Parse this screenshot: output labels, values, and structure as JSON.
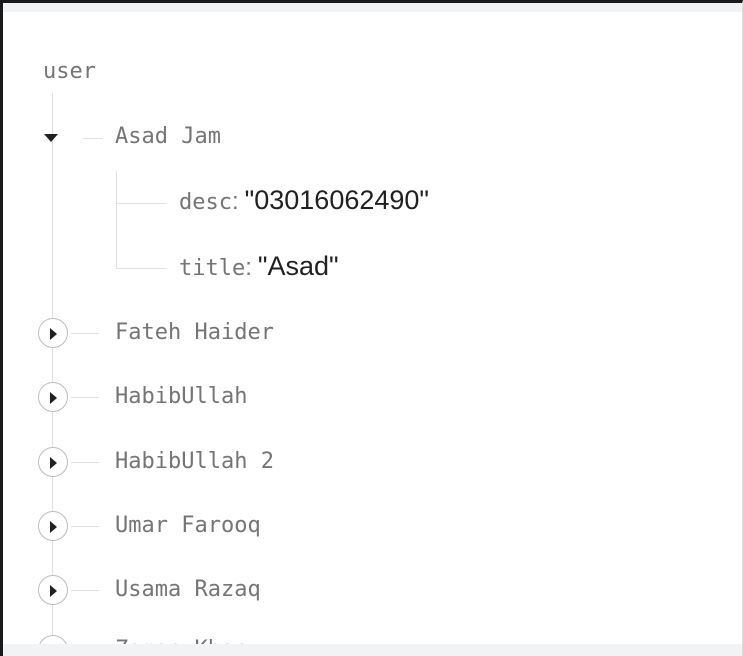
{
  "tree": {
    "root_label": "user",
    "expanded_node": {
      "label": "Asad Jam",
      "fields": [
        {
          "key": "desc",
          "value": "\"03016062490\""
        },
        {
          "key": "title",
          "value": "\"Asad\""
        }
      ]
    },
    "collapsed_nodes": [
      {
        "label": "Fateh Haider"
      },
      {
        "label": "HabibUllah"
      },
      {
        "label": "HabibUllah 2"
      },
      {
        "label": "Umar Farooq"
      },
      {
        "label": "Usama Razaq"
      },
      {
        "label": "Zaman Khan"
      }
    ],
    "colors": {
      "key_text": "#757575",
      "value_text": "#212121",
      "tree_line": "#e0e0e0",
      "button_border": "#bdbdbd"
    },
    "icons": {
      "expanded": "caret-down-icon",
      "collapsed": "expand-circle-icon"
    }
  }
}
